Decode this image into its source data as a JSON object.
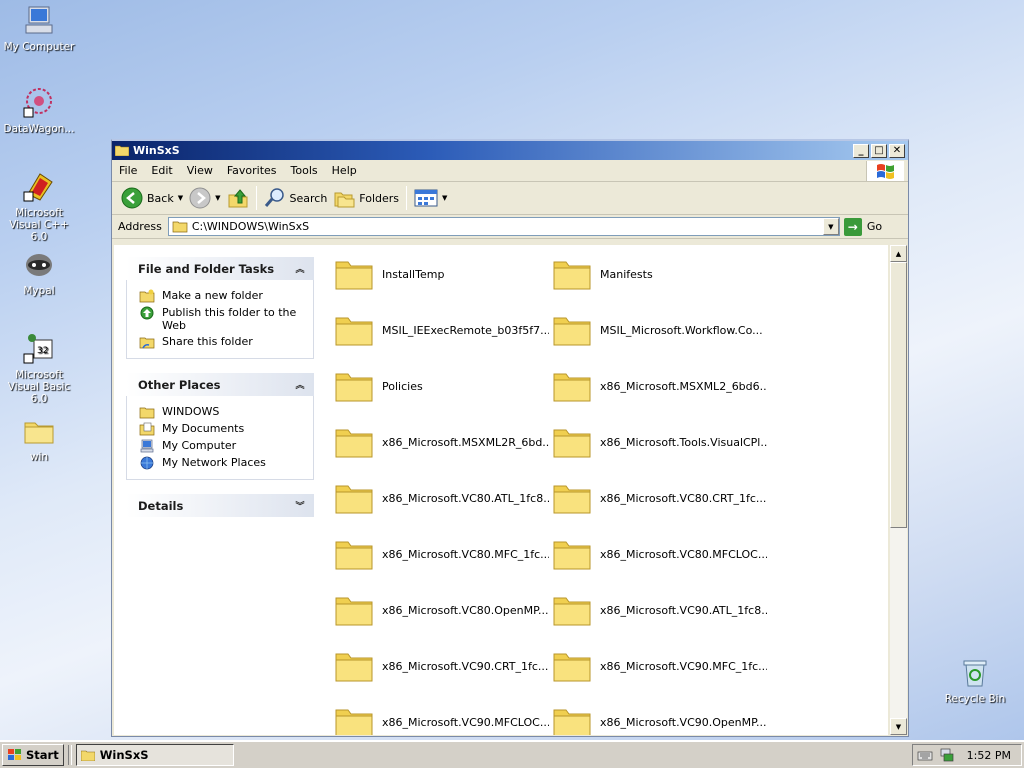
{
  "desktop": {
    "icons": [
      {
        "label": "My Computer",
        "icon": "my-computer-icon"
      },
      {
        "label": "DataWagon...",
        "icon": "datawagon-icon"
      },
      {
        "label": "Microsoft Visual C++ 6.0",
        "icon": "visual-cpp-icon"
      },
      {
        "label": "Mypal",
        "icon": "mypal-icon"
      },
      {
        "label": "Microsoft Visual Basic 6.0",
        "icon": "visual-basic-icon"
      },
      {
        "label": "win",
        "icon": "folder-icon"
      },
      {
        "label": "Recycle Bin",
        "icon": "recycle-bin-icon"
      }
    ]
  },
  "window": {
    "title": "WinSxS",
    "menu": [
      "File",
      "Edit",
      "View",
      "Favorites",
      "Tools",
      "Help"
    ],
    "toolbar": {
      "back": "Back",
      "search": "Search",
      "folders": "Folders"
    },
    "address": {
      "label": "Address",
      "value": "C:\\WINDOWS\\WinSxS",
      "go": "Go"
    },
    "tasks": {
      "file_folder": {
        "title": "File and Folder Tasks",
        "items": [
          "Make a new folder",
          "Publish this folder to the Web",
          "Share this folder"
        ]
      },
      "other_places": {
        "title": "Other Places",
        "items": [
          "WINDOWS",
          "My Documents",
          "My Computer",
          "My Network Places"
        ]
      },
      "details": {
        "title": "Details"
      }
    },
    "folders": [
      "InstallTemp",
      "Manifests",
      "MSIL_IEExecRemote_b03f5f7...",
      "MSIL_Microsoft.Workflow.Co...",
      "Policies",
      "x86_Microsoft.MSXML2_6bd6...",
      "x86_Microsoft.MSXML2R_6bd...",
      "x86_Microsoft.Tools.VisualCPl...",
      "x86_Microsoft.VC80.ATL_1fc8...",
      "x86_Microsoft.VC80.CRT_1fc...",
      "x86_Microsoft.VC80.MFC_1fc...",
      "x86_Microsoft.VC80.MFCLOC...",
      "x86_Microsoft.VC80.OpenMP...",
      "x86_Microsoft.VC90.ATL_1fc8...",
      "x86_Microsoft.VC90.CRT_1fc...",
      "x86_Microsoft.VC90.MFC_1fc...",
      "x86_Microsoft.VC90.MFCLOC...",
      "x86_Microsoft.VC90.OpenMP..."
    ]
  },
  "taskbar": {
    "start": "Start",
    "task": "WinSxS",
    "clock": "1:52 PM"
  }
}
